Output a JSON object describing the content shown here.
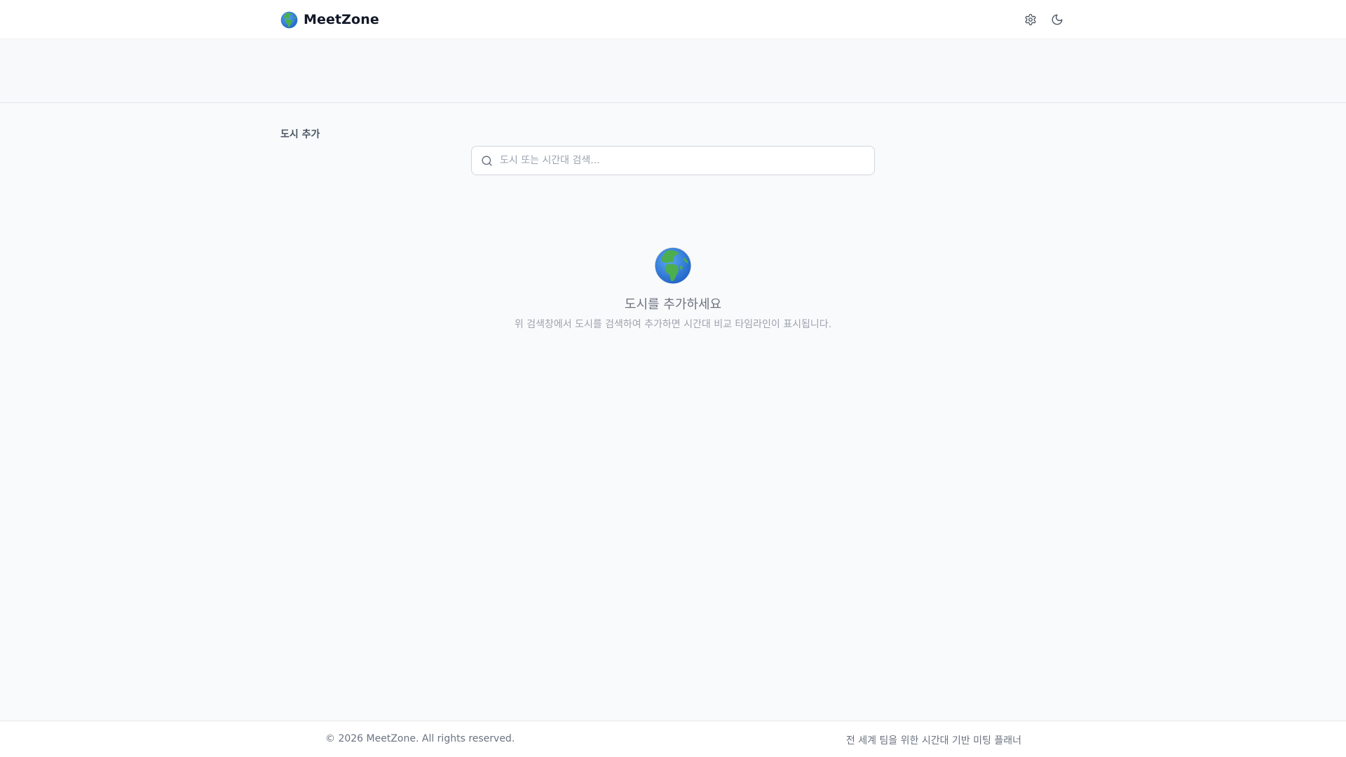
{
  "header": {
    "brand_name": "MeetZone",
    "brand_icon": "globe-europe-africa",
    "actions": [
      {
        "icon": "gear-icon"
      },
      {
        "icon": "moon-icon"
      }
    ]
  },
  "add_city": {
    "section_label": "도시 추가",
    "search": {
      "value": "",
      "placeholder": "도시 또는 시간대 검색..."
    }
  },
  "empty_state": {
    "icon": "globe-europe-africa",
    "title": "도시를 추가하세요",
    "description": "위 검색창에서 도시를 검색하여 추가하면 시간대 비교 타임라인이 표시됩니다."
  },
  "footer": {
    "copyright": "© 2026 MeetZone. All rights reserved.",
    "tagline": "전 세계 팀을 위한 시간대 기반 미팅 플래너"
  },
  "colors": {
    "background": "#f9fafb",
    "surface": "#ffffff",
    "border": "#e5e7eb",
    "text_primary": "#111827",
    "text_muted": "#6b7280",
    "ocean": "#2f7fe0",
    "land": "#4cae4f"
  }
}
